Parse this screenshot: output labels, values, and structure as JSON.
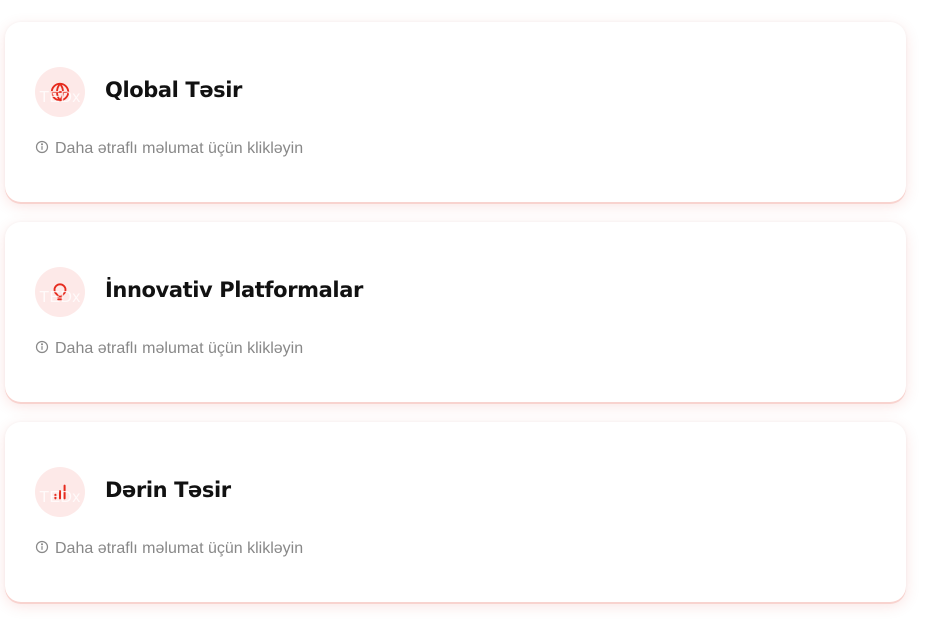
{
  "cards": [
    {
      "title": "Qlobal Təsir",
      "icon": "globe-icon",
      "icon_overlay_text": "TEDx",
      "hint": "Daha ətraflı məlumat üçün klikləyin"
    },
    {
      "title": "İnnovativ Platformalar",
      "icon": "lightbulb-icon",
      "icon_overlay_text": "TEDx",
      "hint": "Daha ətraflı məlumat üçün klikləyin"
    },
    {
      "title": "Dərin Təsir",
      "icon": "bar-chart-icon",
      "icon_overlay_text": "TEDx",
      "hint": "Daha ətraflı məlumat üçün klikləyin"
    }
  ],
  "colors": {
    "accent": "#e62b1e",
    "icon_bg": "#fde9e8",
    "title": "#111111",
    "hint": "#888888",
    "card_shadow": "#f8d3cf"
  }
}
